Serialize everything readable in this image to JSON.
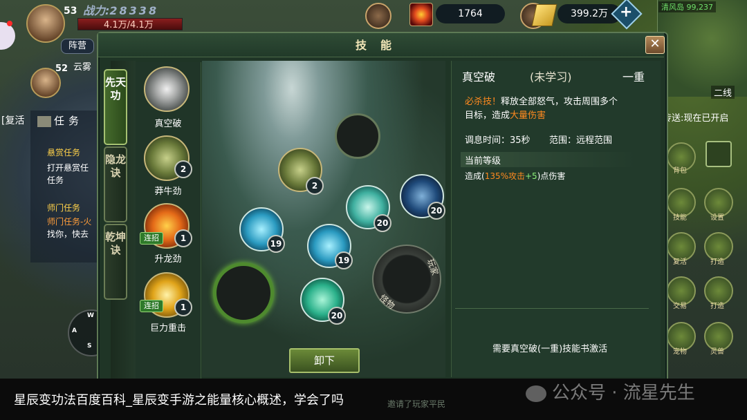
{
  "hud": {
    "player_level": "53",
    "power_label": "战力:",
    "power_value": "28338",
    "hp_text": "4.1万/4.1万",
    "faction_btn": "阵营",
    "pet_level": "52",
    "pet_name": "云雾",
    "currency1": "1764",
    "currency2": "399.2万",
    "server_text": "清风岛 99,237",
    "quest_tab": "任务",
    "revive_tab": "[复活",
    "quest_lines": [
      "悬赏任务",
      "打开悬赏任",
      "任务",
      "师门任务",
      "师门任务-火",
      "找你，快去"
    ],
    "line_label": "二线",
    "transfer_text": "传送:现在已开启",
    "right_menu": [
      "背包",
      "设置",
      "技能",
      "复活",
      "打造",
      "交易",
      "灵兽",
      "宠物"
    ],
    "joystick": [
      "W",
      "A",
      "D",
      "S"
    ],
    "chat_bits": [
      "邀请了玩家平民"
    ]
  },
  "panel": {
    "title": "技能",
    "close": "✕",
    "tabs": [
      "先天功",
      "隐龙诀",
      "乾坤诀"
    ],
    "skills": [
      {
        "name": "真空破",
        "level": null,
        "combo": null
      },
      {
        "name": "莽牛劲",
        "level": "2",
        "combo": null
      },
      {
        "name": "升龙劲",
        "level": "1",
        "combo": "连招"
      },
      {
        "name": "巨力重击",
        "level": "1",
        "combo": "连招"
      }
    ],
    "stage_levels": [
      "2",
      "20",
      "20",
      "19",
      "19",
      "20"
    ],
    "dial_labels": [
      "玩家",
      "怪物"
    ],
    "unequip": "卸下",
    "info": {
      "name": "真空破",
      "status": "(未学习)",
      "rank": "一重",
      "desc_tag": "必杀技！",
      "desc_1": "释放全部怒气，攻击周围多个",
      "desc_2a": "目标，造成",
      "desc_2b": "大量伤害",
      "cooldown": "调息时间：35秒",
      "range": "范围：远程范围",
      "current_level": "当前等级",
      "effect_pre": "造成(",
      "effect_pct": "135%攻击",
      "effect_plus": "+5",
      "effect_post": ")点伤害",
      "activate": "需要真空破(一重)技能书激活"
    }
  },
  "caption": "星辰变功法百度百科_星辰变手游之能量核心概述，学会了吗",
  "watermark": "公众号 · 流星先生",
  "colors": {
    "accent_orange": "#ff8a1f",
    "accent_green": "#8ef07a",
    "accent_red": "#ff3b2f"
  }
}
